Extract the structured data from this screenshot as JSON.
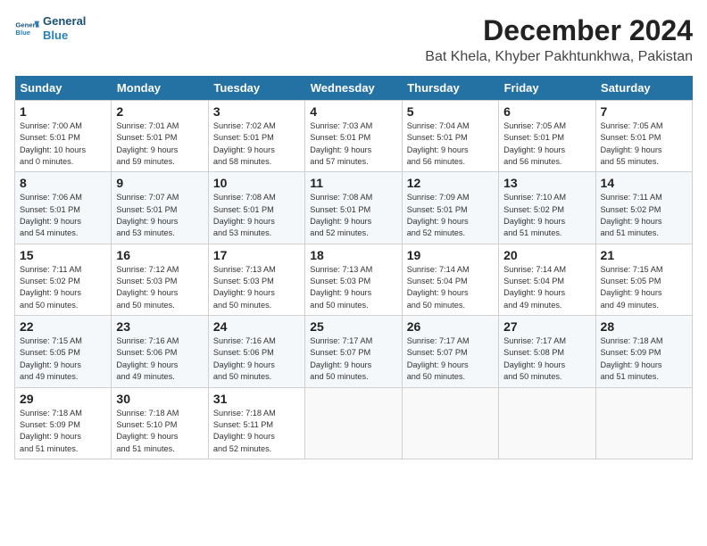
{
  "header": {
    "logo_line1": "General",
    "logo_line2": "Blue",
    "title": "December 2024",
    "subtitle": "Bat Khela, Khyber Pakhtunkhwa, Pakistan"
  },
  "columns": [
    "Sunday",
    "Monday",
    "Tuesday",
    "Wednesday",
    "Thursday",
    "Friday",
    "Saturday"
  ],
  "weeks": [
    [
      {
        "day": "1",
        "info": "Sunrise: 7:00 AM\nSunset: 5:01 PM\nDaylight: 10 hours\nand 0 minutes."
      },
      {
        "day": "2",
        "info": "Sunrise: 7:01 AM\nSunset: 5:01 PM\nDaylight: 9 hours\nand 59 minutes."
      },
      {
        "day": "3",
        "info": "Sunrise: 7:02 AM\nSunset: 5:01 PM\nDaylight: 9 hours\nand 58 minutes."
      },
      {
        "day": "4",
        "info": "Sunrise: 7:03 AM\nSunset: 5:01 PM\nDaylight: 9 hours\nand 57 minutes."
      },
      {
        "day": "5",
        "info": "Sunrise: 7:04 AM\nSunset: 5:01 PM\nDaylight: 9 hours\nand 56 minutes."
      },
      {
        "day": "6",
        "info": "Sunrise: 7:05 AM\nSunset: 5:01 PM\nDaylight: 9 hours\nand 56 minutes."
      },
      {
        "day": "7",
        "info": "Sunrise: 7:05 AM\nSunset: 5:01 PM\nDaylight: 9 hours\nand 55 minutes."
      }
    ],
    [
      {
        "day": "8",
        "info": "Sunrise: 7:06 AM\nSunset: 5:01 PM\nDaylight: 9 hours\nand 54 minutes."
      },
      {
        "day": "9",
        "info": "Sunrise: 7:07 AM\nSunset: 5:01 PM\nDaylight: 9 hours\nand 53 minutes."
      },
      {
        "day": "10",
        "info": "Sunrise: 7:08 AM\nSunset: 5:01 PM\nDaylight: 9 hours\nand 53 minutes."
      },
      {
        "day": "11",
        "info": "Sunrise: 7:08 AM\nSunset: 5:01 PM\nDaylight: 9 hours\nand 52 minutes."
      },
      {
        "day": "12",
        "info": "Sunrise: 7:09 AM\nSunset: 5:01 PM\nDaylight: 9 hours\nand 52 minutes."
      },
      {
        "day": "13",
        "info": "Sunrise: 7:10 AM\nSunset: 5:02 PM\nDaylight: 9 hours\nand 51 minutes."
      },
      {
        "day": "14",
        "info": "Sunrise: 7:11 AM\nSunset: 5:02 PM\nDaylight: 9 hours\nand 51 minutes."
      }
    ],
    [
      {
        "day": "15",
        "info": "Sunrise: 7:11 AM\nSunset: 5:02 PM\nDaylight: 9 hours\nand 50 minutes."
      },
      {
        "day": "16",
        "info": "Sunrise: 7:12 AM\nSunset: 5:03 PM\nDaylight: 9 hours\nand 50 minutes."
      },
      {
        "day": "17",
        "info": "Sunrise: 7:13 AM\nSunset: 5:03 PM\nDaylight: 9 hours\nand 50 minutes."
      },
      {
        "day": "18",
        "info": "Sunrise: 7:13 AM\nSunset: 5:03 PM\nDaylight: 9 hours\nand 50 minutes."
      },
      {
        "day": "19",
        "info": "Sunrise: 7:14 AM\nSunset: 5:04 PM\nDaylight: 9 hours\nand 50 minutes."
      },
      {
        "day": "20",
        "info": "Sunrise: 7:14 AM\nSunset: 5:04 PM\nDaylight: 9 hours\nand 49 minutes."
      },
      {
        "day": "21",
        "info": "Sunrise: 7:15 AM\nSunset: 5:05 PM\nDaylight: 9 hours\nand 49 minutes."
      }
    ],
    [
      {
        "day": "22",
        "info": "Sunrise: 7:15 AM\nSunset: 5:05 PM\nDaylight: 9 hours\nand 49 minutes."
      },
      {
        "day": "23",
        "info": "Sunrise: 7:16 AM\nSunset: 5:06 PM\nDaylight: 9 hours\nand 49 minutes."
      },
      {
        "day": "24",
        "info": "Sunrise: 7:16 AM\nSunset: 5:06 PM\nDaylight: 9 hours\nand 50 minutes."
      },
      {
        "day": "25",
        "info": "Sunrise: 7:17 AM\nSunset: 5:07 PM\nDaylight: 9 hours\nand 50 minutes."
      },
      {
        "day": "26",
        "info": "Sunrise: 7:17 AM\nSunset: 5:07 PM\nDaylight: 9 hours\nand 50 minutes."
      },
      {
        "day": "27",
        "info": "Sunrise: 7:17 AM\nSunset: 5:08 PM\nDaylight: 9 hours\nand 50 minutes."
      },
      {
        "day": "28",
        "info": "Sunrise: 7:18 AM\nSunset: 5:09 PM\nDaylight: 9 hours\nand 51 minutes."
      }
    ],
    [
      {
        "day": "29",
        "info": "Sunrise: 7:18 AM\nSunset: 5:09 PM\nDaylight: 9 hours\nand 51 minutes."
      },
      {
        "day": "30",
        "info": "Sunrise: 7:18 AM\nSunset: 5:10 PM\nDaylight: 9 hours\nand 51 minutes."
      },
      {
        "day": "31",
        "info": "Sunrise: 7:18 AM\nSunset: 5:11 PM\nDaylight: 9 hours\nand 52 minutes."
      },
      {
        "day": "",
        "info": ""
      },
      {
        "day": "",
        "info": ""
      },
      {
        "day": "",
        "info": ""
      },
      {
        "day": "",
        "info": ""
      }
    ]
  ]
}
